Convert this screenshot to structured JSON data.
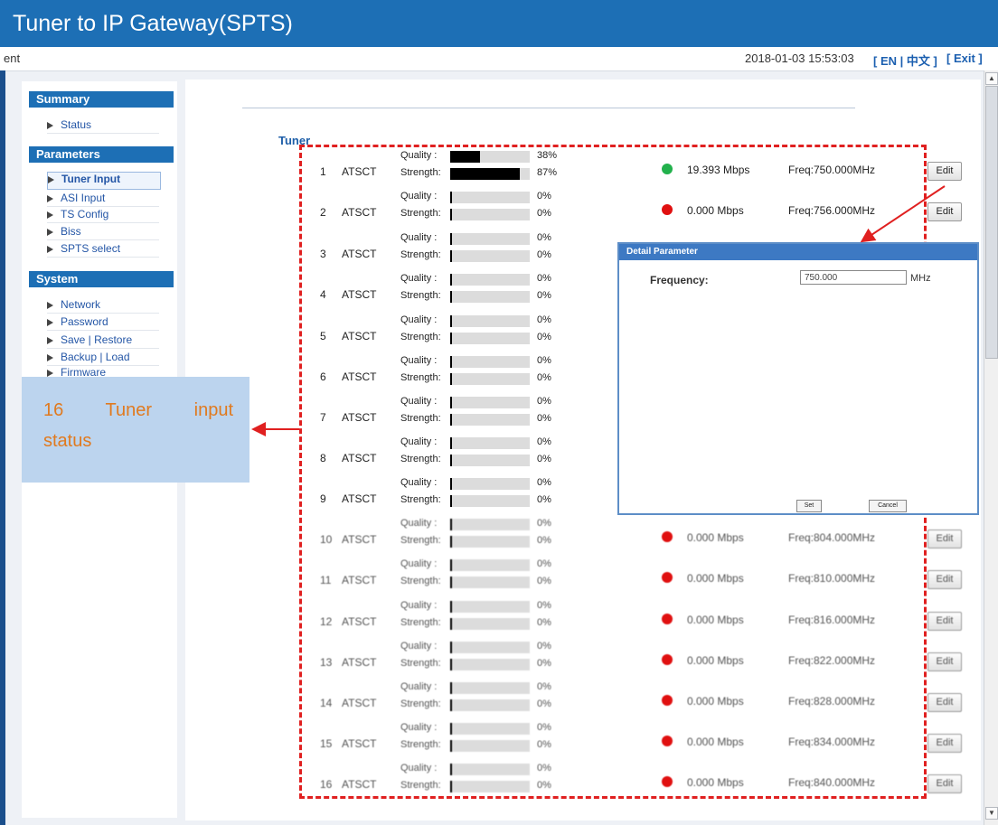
{
  "header": {
    "title": "Tuner to IP Gateway(SPTS)"
  },
  "infobar": {
    "left_text": "ent",
    "datetime": "2018-01-03 15:53:03",
    "lang_en": "[ EN | 中文 ]",
    "exit": "[ Exit ]"
  },
  "sidebar": {
    "sections": [
      {
        "title": "Summary",
        "items": [
          "Status"
        ]
      },
      {
        "title": "Parameters",
        "items": [
          "Tuner Input",
          "ASI Input",
          "TS Config",
          "Biss",
          "SPTS select"
        ],
        "active": "Tuner Input"
      },
      {
        "title": "System",
        "items": [
          "Network",
          "Password",
          "Save | Restore",
          "Backup | Load",
          "Firmware"
        ]
      }
    ]
  },
  "main": {
    "section_title": "Tuner",
    "quality_label": "Quality  :",
    "strength_label": "Strength:",
    "edit_label": "Edit",
    "tuners": [
      {
        "num": "1",
        "mode": "ATSCT",
        "quality": 38,
        "quality_text": "38%",
        "strength": 87,
        "strength_text": "87%",
        "status": "green",
        "rate": "19.393 Mbps",
        "freq": "Freq:750.000MHz"
      },
      {
        "num": "2",
        "mode": "ATSCT",
        "quality": 0,
        "quality_text": "0%",
        "strength": 0,
        "strength_text": "0%",
        "status": "red",
        "rate": "0.000 Mbps",
        "freq": "Freq:756.000MHz"
      },
      {
        "num": "3",
        "mode": "ATSCT",
        "quality": 0,
        "quality_text": "0%",
        "strength": 0,
        "strength_text": "0%"
      },
      {
        "num": "4",
        "mode": "ATSCT",
        "quality": 0,
        "quality_text": "0%",
        "strength": 0,
        "strength_text": "0%"
      },
      {
        "num": "5",
        "mode": "ATSCT",
        "quality": 0,
        "quality_text": "0%",
        "strength": 0,
        "strength_text": "0%"
      },
      {
        "num": "6",
        "mode": "ATSCT",
        "quality": 0,
        "quality_text": "0%",
        "strength": 0,
        "strength_text": "0%"
      },
      {
        "num": "7",
        "mode": "ATSCT",
        "quality": 0,
        "quality_text": "0%",
        "strength": 0,
        "strength_text": "0%"
      },
      {
        "num": "8",
        "mode": "ATSCT",
        "quality": 0,
        "quality_text": "0%",
        "strength": 0,
        "strength_text": "0%"
      },
      {
        "num": "9",
        "mode": "ATSCT",
        "quality": 0,
        "quality_text": "0%",
        "strength": 0,
        "strength_text": "0%"
      },
      {
        "num": "10",
        "mode": "ATSCT",
        "quality": 0,
        "quality_text": "0%",
        "strength": 0,
        "strength_text": "0%",
        "status": "red",
        "rate": "0.000 Mbps",
        "freq": "Freq:804.000MHz"
      },
      {
        "num": "11",
        "mode": "ATSCT",
        "quality": 0,
        "quality_text": "0%",
        "strength": 0,
        "strength_text": "0%",
        "status": "red",
        "rate": "0.000 Mbps",
        "freq": "Freq:810.000MHz"
      },
      {
        "num": "12",
        "mode": "ATSCT",
        "quality": 0,
        "quality_text": "0%",
        "strength": 0,
        "strength_text": "0%",
        "status": "red",
        "rate": "0.000 Mbps",
        "freq": "Freq:816.000MHz"
      },
      {
        "num": "13",
        "mode": "ATSCT",
        "quality": 0,
        "quality_text": "0%",
        "strength": 0,
        "strength_text": "0%",
        "status": "red",
        "rate": "0.000 Mbps",
        "freq": "Freq:822.000MHz"
      },
      {
        "num": "14",
        "mode": "ATSCT",
        "quality": 0,
        "quality_text": "0%",
        "strength": 0,
        "strength_text": "0%",
        "status": "red",
        "rate": "0.000 Mbps",
        "freq": "Freq:828.000MHz"
      },
      {
        "num": "15",
        "mode": "ATSCT",
        "quality": 0,
        "quality_text": "0%",
        "strength": 0,
        "strength_text": "0%",
        "status": "red",
        "rate": "0.000 Mbps",
        "freq": "Freq:834.000MHz"
      },
      {
        "num": "16",
        "mode": "ATSCT",
        "quality": 0,
        "quality_text": "0%",
        "strength": 0,
        "strength_text": "0%",
        "status": "red",
        "rate": "0.000 Mbps",
        "freq": "Freq:840.000MHz"
      }
    ]
  },
  "dialog": {
    "title": "Detail Parameter",
    "frequency_label": "Frequency:",
    "frequency_value": "750.000",
    "unit": "MHz",
    "set_label": "Set",
    "cancel_label": "Cancel"
  },
  "callout": {
    "text": "16 Tuner input status"
  },
  "colors": {
    "header": "#1d6fb5",
    "accent_link": "#1b5fb0",
    "status_green": "#22b14c",
    "status_red": "#e01010",
    "annotation_red": "#e02020",
    "callout_bg": "#bcd4ee",
    "callout_text": "#e07a1f"
  }
}
